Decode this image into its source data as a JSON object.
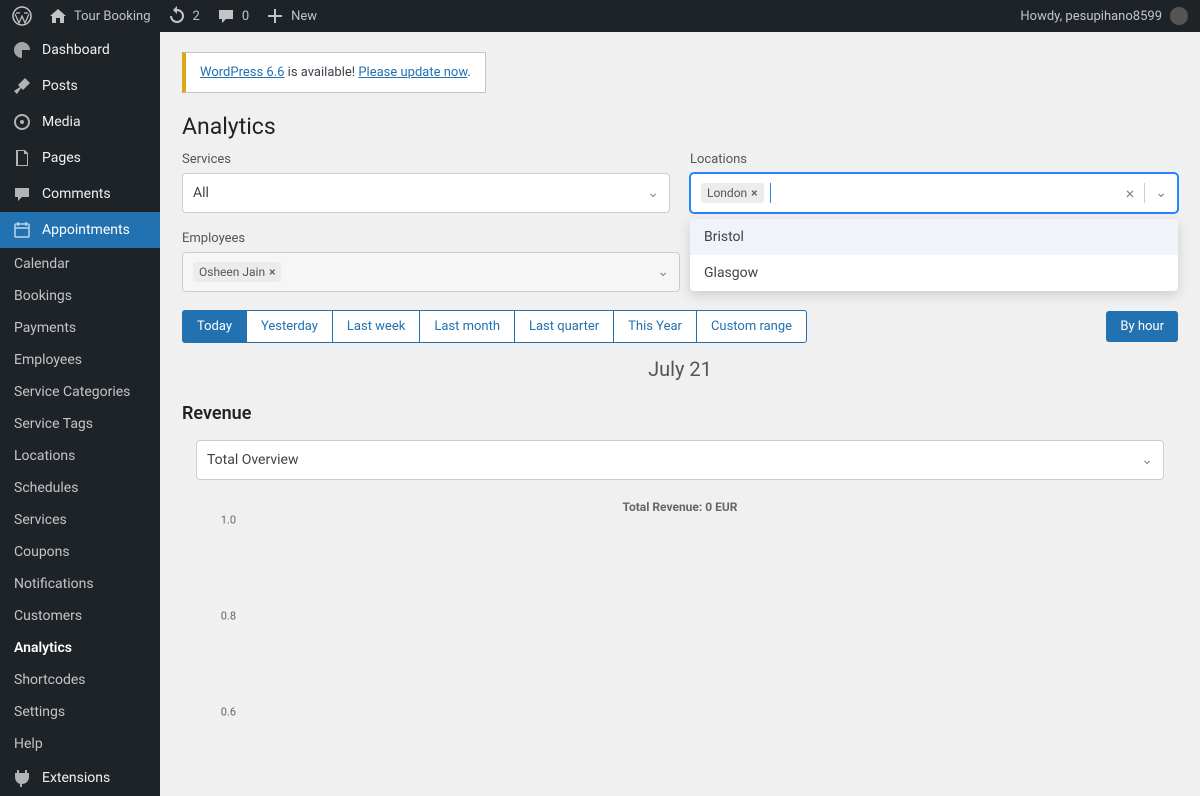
{
  "topbar": {
    "site_name": "Tour Booking",
    "updates_count": "2",
    "comments_count": "0",
    "new_label": "New",
    "howdy": "Howdy, pesupihano8599"
  },
  "sidebar": {
    "main": [
      {
        "label": "Dashboard"
      },
      {
        "label": "Posts"
      },
      {
        "label": "Media"
      },
      {
        "label": "Pages"
      },
      {
        "label": "Comments"
      },
      {
        "label": "Appointments"
      }
    ],
    "sub": [
      {
        "label": "Calendar"
      },
      {
        "label": "Bookings"
      },
      {
        "label": "Payments"
      },
      {
        "label": "Employees"
      },
      {
        "label": "Service Categories"
      },
      {
        "label": "Service Tags"
      },
      {
        "label": "Locations"
      },
      {
        "label": "Schedules"
      },
      {
        "label": "Services"
      },
      {
        "label": "Coupons"
      },
      {
        "label": "Notifications"
      },
      {
        "label": "Customers"
      },
      {
        "label": "Analytics"
      },
      {
        "label": "Shortcodes"
      },
      {
        "label": "Settings"
      },
      {
        "label": "Help"
      }
    ],
    "extensions": "Extensions"
  },
  "notice": {
    "link1": "WordPress 6.6",
    "text": " is available! ",
    "link2": "Please update now"
  },
  "page": {
    "title": "Analytics"
  },
  "filters": {
    "services": {
      "label": "Services",
      "value": "All"
    },
    "locations": {
      "label": "Locations",
      "chip": "London",
      "options": [
        "Bristol",
        "Glasgow"
      ]
    },
    "employees": {
      "label": "Employees",
      "chip": "Osheen Jain"
    }
  },
  "ranges": [
    "Today",
    "Yesterday",
    "Last week",
    "Last month",
    "Last quarter",
    "This Year",
    "Custom range"
  ],
  "byhour": "By hour",
  "date_heading": "July 21",
  "revenue": {
    "title": "Revenue",
    "select": "Total Overview",
    "chart_title": "Total Revenue: 0 EUR"
  },
  "chart_data": {
    "type": "line",
    "title": "Total Revenue: 0 EUR",
    "y_ticks": [
      "1.0",
      "0.8",
      "0.6"
    ],
    "ylim": [
      0.6,
      1.0
    ],
    "values": []
  }
}
